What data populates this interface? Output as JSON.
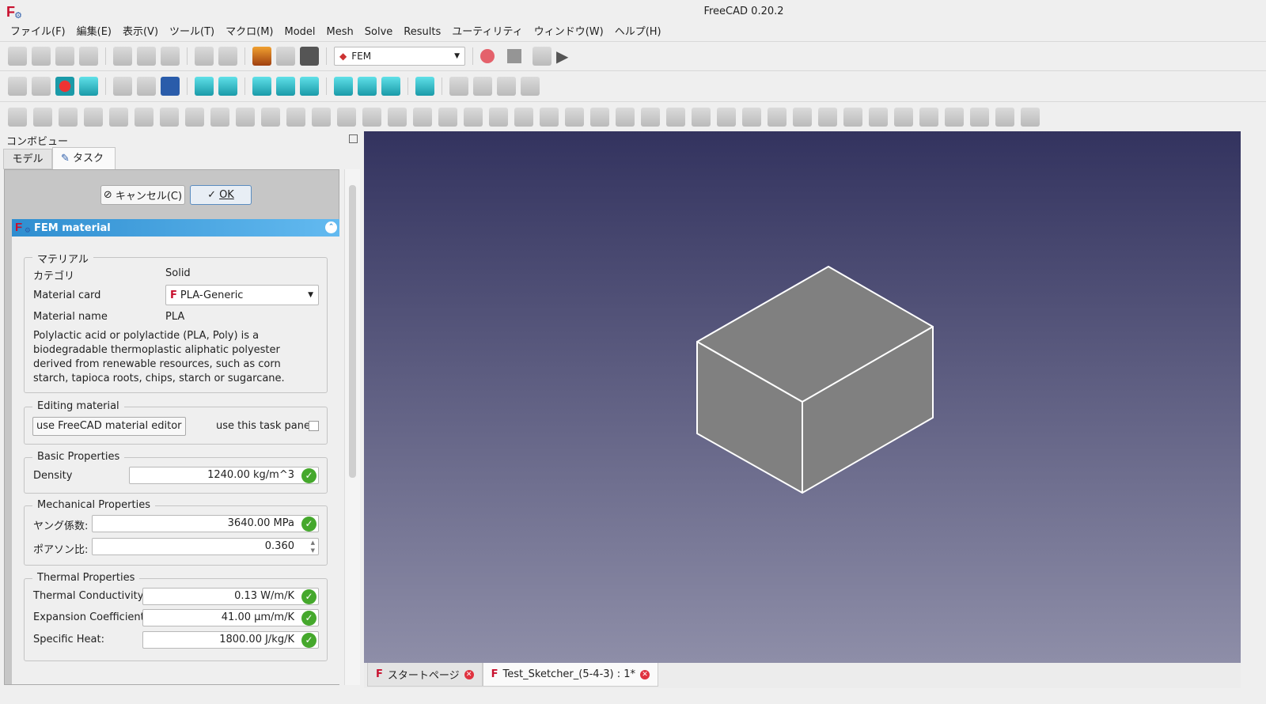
{
  "window": {
    "title": "FreeCAD 0.20.2"
  },
  "menu": [
    "ファイル(F)",
    "編集(E)",
    "表示(V)",
    "ツール(T)",
    "マクロ(M)",
    "Model",
    "Mesh",
    "Solve",
    "Results",
    "ユーティリティ",
    "ウィンドウ(W)",
    "ヘルプ(H)"
  ],
  "toolbar": {
    "workbench": "FEM"
  },
  "combo": {
    "title": "コンボビュー",
    "tabs": [
      "モデル",
      "タスク"
    ],
    "cancel": "キャンセル(C)",
    "ok": "OK"
  },
  "fem": {
    "title": "FEM material",
    "material_group": "マテリアル",
    "category_label": "カテゴリ",
    "category": "Solid",
    "card_label": "Material card",
    "card": "PLA-Generic",
    "name_label": "Material name",
    "name": "PLA",
    "description": "Polylactic acid or polylactide (PLA, Poly) is a biodegradable thermoplastic aliphatic polyester derived from renewable resources, such as corn starch, tapioca roots, chips, starch or sugarcane.",
    "editing_group": "Editing material",
    "editor_button": "use FreeCAD material editor",
    "task_panel_label": "use this task panel",
    "basic_group": "Basic Properties",
    "density_label": "Density",
    "density": "1240.00 kg/m^3",
    "mech_group": "Mechanical Properties",
    "young_label": "ヤング係数:",
    "young": "3640.00 MPa",
    "poisson_label": "ポアソン比:",
    "poisson": "0.360",
    "thermal_group": "Thermal  Properties",
    "tc_label": "Thermal Conductivity:",
    "tc": "0.13 W/m/K",
    "ec_label": "Expansion Coefficient:",
    "ec": "41.00 µm/m/K",
    "sh_label": "Specific Heat:",
    "sh": "1800.00 J/kg/K"
  },
  "doc_tabs": [
    "スタートページ",
    "Test_Sketcher_(5-4-3) : 1*"
  ]
}
